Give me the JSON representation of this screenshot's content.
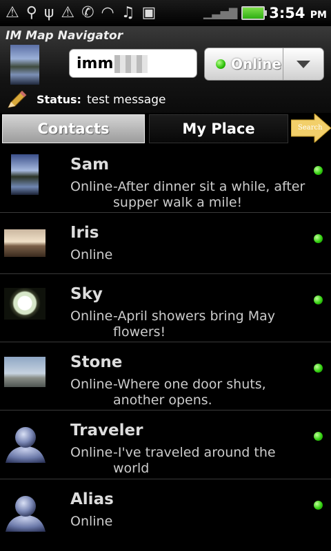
{
  "statusbar": {
    "time": "3:54",
    "ampm": "PM"
  },
  "header": {
    "app_title": "IM Map Navigator",
    "username": "imm",
    "presence": "Online",
    "status_label": "Status:",
    "status_message": "test message"
  },
  "tabs": {
    "contacts": "Contacts",
    "my_place": "My Place",
    "search": "Search"
  },
  "contacts": [
    {
      "name": "Sam",
      "presence": "Online",
      "message": "-After dinner sit a while, after supper walk a mile!",
      "avatar": "landscape-photo"
    },
    {
      "name": "Iris",
      "presence": "Online",
      "message": "",
      "avatar": "beach-photo"
    },
    {
      "name": "Sky",
      "presence": "Online",
      "message": "-April showers bring May flowers!",
      "avatar": "flower-photo"
    },
    {
      "name": "Stone",
      "presence": "Online",
      "message": "-Where one door shuts, another opens.",
      "avatar": "church-photo"
    },
    {
      "name": "Traveler",
      "presence": "Online",
      "message": "-I've traveled around the world",
      "avatar": "default-user-icon"
    },
    {
      "name": "Alias",
      "presence": "Online",
      "message": "",
      "avatar": "default-user-icon"
    }
  ],
  "colors": {
    "online": "#2ec10a",
    "background": "#000000",
    "tab_active": "#b8b8b8"
  }
}
